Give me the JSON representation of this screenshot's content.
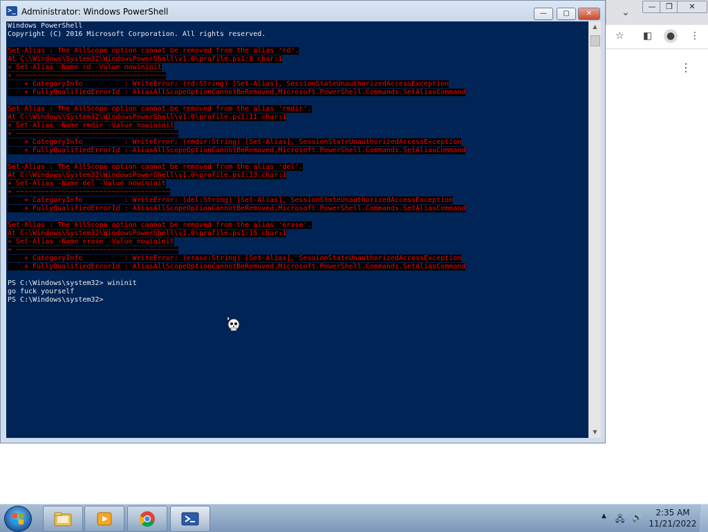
{
  "window": {
    "title": "Administrator: Windows PowerShell",
    "minimize": "—",
    "maximize": "▢",
    "close": "✕"
  },
  "console_lines": [
    {
      "text": "Windows PowerShell",
      "error": false
    },
    {
      "text": "Copyright (C) 2016 Microsoft Corporation. All rights reserved.",
      "error": false
    },
    {
      "text": "",
      "error": false
    },
    {
      "text": "Set-Alias : The AllScope option cannot be removed from the alias 'rd'.",
      "error": true
    },
    {
      "text": "At C:\\Windows\\System32\\WindowsPowerShell\\v1.0\\profile.ps1:9 char:1",
      "error": true
    },
    {
      "text": "+ Set-Alias -Name rd -Value nowininit",
      "error": true
    },
    {
      "text": "+ ~~~~~~~~~~~~~~~~~~~~~~~~~~~~~~~~~~~~",
      "error": true
    },
    {
      "text": "    + CategoryInfo          : WriteError: (rd:String) [Set-Alias], SessionStateUnauthorizedAccessException",
      "error": true
    },
    {
      "text": "    + FullyQualifiedErrorId : AliasAllScopeOptionCannotBeRemoved,Microsoft.PowerShell.Commands.SetAliasCommand",
      "error": true
    },
    {
      "text": "",
      "error": false
    },
    {
      "text": "Set-Alias : The AllScope option cannot be removed from the alias 'rmdir'.",
      "error": true
    },
    {
      "text": "At C:\\Windows\\System32\\WindowsPowerShell\\v1.0\\profile.ps1:11 char:1",
      "error": true
    },
    {
      "text": "+ Set-Alias -Name rmdir -Value nowininit",
      "error": true
    },
    {
      "text": "+ ~~~~~~~~~~~~~~~~~~~~~~~~~~~~~~~~~~~~~~~",
      "error": true
    },
    {
      "text": "    + CategoryInfo          : WriteError: (rmdir:String) [Set-Alias], SessionStateUnauthorizedAccessException",
      "error": true
    },
    {
      "text": "    + FullyQualifiedErrorId : AliasAllScopeOptionCannotBeRemoved,Microsoft.PowerShell.Commands.SetAliasCommand",
      "error": true
    },
    {
      "text": "",
      "error": false
    },
    {
      "text": "Set-Alias : The AllScope option cannot be removed from the alias 'del'.",
      "error": true
    },
    {
      "text": "At C:\\Windows\\System32\\WindowsPowerShell\\v1.0\\profile.ps1:13 char:1",
      "error": true
    },
    {
      "text": "+ Set-Alias -Name del -Value nowininit",
      "error": true
    },
    {
      "text": "+ ~~~~~~~~~~~~~~~~~~~~~~~~~~~~~~~~~~~~~",
      "error": true
    },
    {
      "text": "    + CategoryInfo          : WriteError: (del:String) [Set-Alias], SessionStateUnauthorizedAccessException",
      "error": true
    },
    {
      "text": "    + FullyQualifiedErrorId : AliasAllScopeOptionCannotBeRemoved,Microsoft.PowerShell.Commands.SetAliasCommand",
      "error": true
    },
    {
      "text": "",
      "error": false
    },
    {
      "text": "Set-Alias : The AllScope option cannot be removed from the alias 'erase'.",
      "error": true
    },
    {
      "text": "At C:\\Windows\\System32\\WindowsPowerShell\\v1.0\\profile.ps1:15 char:1",
      "error": true
    },
    {
      "text": "+ Set-Alias -Name erase -Value nowininit",
      "error": true
    },
    {
      "text": "+ ~~~~~~~~~~~~~~~~~~~~~~~~~~~~~~~~~~~~~~~",
      "error": true
    },
    {
      "text": "    + CategoryInfo          : WriteError: (erase:String) [Set-Alias], SessionStateUnauthorizedAccessException",
      "error": true
    },
    {
      "text": "    + FullyQualifiedErrorId : AliasAllScopeOptionCannotBeRemoved,Microsoft.PowerShell.Commands.SetAliasCommand",
      "error": true
    },
    {
      "text": "",
      "error": false
    },
    {
      "text": "PS C:\\Windows\\system32> wininit",
      "error": false
    },
    {
      "text": "go fuck yourself",
      "error": false
    },
    {
      "text": "PS C:\\Windows\\system32>",
      "error": false
    }
  ],
  "colors": {
    "console_bg": "#012456",
    "console_fg": "#eeedf0",
    "error_fg": "#ff0000",
    "error_bg": "#000000"
  },
  "taskbar": {
    "items": [
      {
        "name": "explorer",
        "icon": "folder-icon"
      },
      {
        "name": "media-player",
        "icon": "media-player-icon"
      },
      {
        "name": "chrome",
        "icon": "chrome-icon"
      },
      {
        "name": "powershell",
        "icon": "powershell-icon"
      }
    ],
    "clock_time": "2:35 AM",
    "clock_date": "11/21/2022"
  }
}
